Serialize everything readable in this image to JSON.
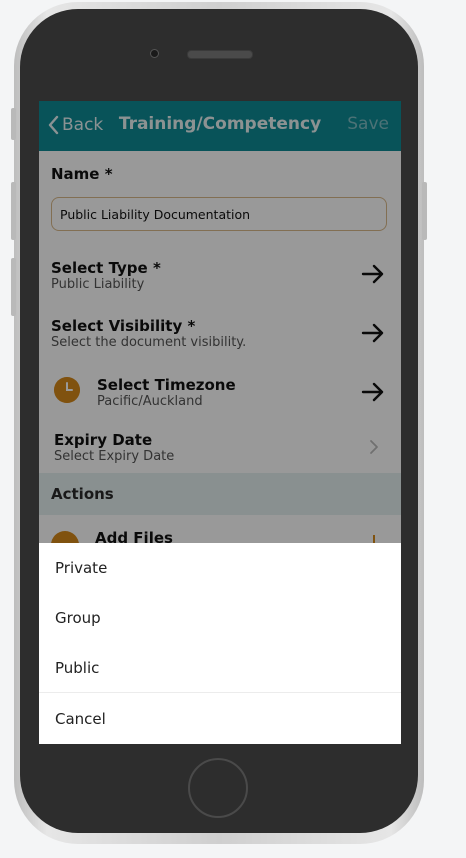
{
  "nav": {
    "back_label": "Back",
    "title": "Training/Competency",
    "save_label": "Save"
  },
  "form": {
    "name_label": "Name *",
    "name_value": "Public Liability Documentation",
    "type_label": "Select Type *",
    "type_value": "Public Liability",
    "visibility_label": "Select Visibility *",
    "visibility_value": "Select the document visibility.",
    "timezone_label": "Select Timezone",
    "timezone_value": "Pacific/Auckland",
    "expiry_label": "Expiry Date",
    "expiry_value": "Select Expiry Date"
  },
  "actions": {
    "header": "Actions",
    "add_files_label": "Add Files"
  },
  "sheet": {
    "options": [
      "Private",
      "Group",
      "Public"
    ],
    "cancel_label": "Cancel"
  },
  "colors": {
    "nav_bg": "#0e8a95",
    "accent_orange": "#d6891a",
    "actions_bg": "#e5f0f1"
  },
  "icons": {
    "back": "chevron-left-icon",
    "row_arrow": "arrow-right-icon",
    "timezone": "clock-icon",
    "expiry": "chevron-right-icon",
    "add_files": "paperclip-icon"
  }
}
